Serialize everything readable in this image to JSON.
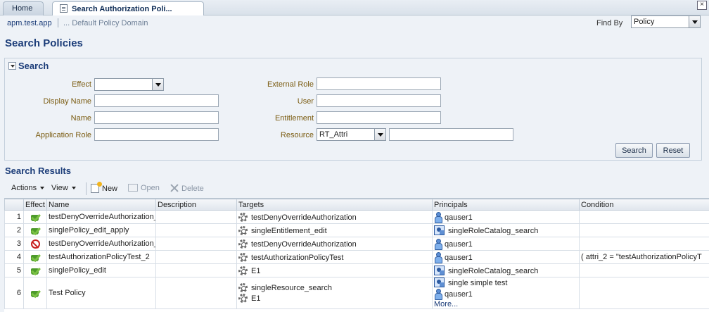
{
  "tabs": {
    "home": "Home",
    "active": "Search Authorization Poli..."
  },
  "breadcrumb": {
    "app": "apm.test.app",
    "domain": "... Default Policy Domain"
  },
  "find_by": {
    "label": "Find By",
    "value": "Policy"
  },
  "page_title": "Search Policies",
  "search": {
    "header": "Search",
    "effect_label": "Effect",
    "effect_value": "",
    "display_name_label": "Display Name",
    "name_label": "Name",
    "application_role_label": "Application Role",
    "external_role_label": "External Role",
    "user_label": "User",
    "entitlement_label": "Entitlement",
    "resource_label": "Resource",
    "resource_type_value": "RT_Attri",
    "resource_value": "",
    "search_button": "Search",
    "reset_button": "Reset"
  },
  "results": {
    "title": "Search Results",
    "toolbar": {
      "actions": "Actions",
      "view": "View",
      "new": "New",
      "open": "Open",
      "delete": "Delete"
    },
    "columns": [
      "",
      "Effect",
      "Name",
      "Description",
      "Targets",
      "Principals",
      "Condition"
    ],
    "rows": [
      {
        "num": "1",
        "effect": "grant",
        "name": "testDenyOverrideAuthorization_",
        "description": "",
        "targets": [
          {
            "icon": "entitlement-gear-icon",
            "text": "testDenyOverrideAuthorization"
          }
        ],
        "principals": [
          {
            "icon": "user-icon",
            "text": "qauser1"
          }
        ],
        "more": "",
        "condition": ""
      },
      {
        "num": "2",
        "effect": "grant",
        "name": "singlePolicy_edit_apply",
        "description": "",
        "targets": [
          {
            "icon": "resource-gear-icon",
            "text": "singleEntitlement_edit"
          }
        ],
        "principals": [
          {
            "icon": "app-role-icon",
            "text": "singleRoleCatalog_search"
          }
        ],
        "more": "",
        "condition": ""
      },
      {
        "num": "3",
        "effect": "deny",
        "name": "testDenyOverrideAuthorization_",
        "description": "",
        "targets": [
          {
            "icon": "entitlement-gear-icon",
            "text": "testDenyOverrideAuthorization"
          }
        ],
        "principals": [
          {
            "icon": "user-icon",
            "text": "qauser1"
          }
        ],
        "more": "",
        "condition": ""
      },
      {
        "num": "4",
        "effect": "grant",
        "name": "testAuthorizationPolicyTest_2",
        "description": "",
        "targets": [
          {
            "icon": "entitlement-gear-icon",
            "text": "testAuthorizationPolicyTest"
          }
        ],
        "principals": [
          {
            "icon": "user-icon",
            "text": "qauser1"
          }
        ],
        "more": "",
        "condition": "( attri_2 = \"testAuthorizationPolicyT"
      },
      {
        "num": "5",
        "effect": "grant",
        "name": "singlePolicy_edit",
        "description": "",
        "targets": [
          {
            "icon": "resource-gear-icon",
            "text": "E1"
          }
        ],
        "principals": [
          {
            "icon": "app-role-icon",
            "text": "singleRoleCatalog_search"
          }
        ],
        "more": "",
        "condition": ""
      },
      {
        "num": "6",
        "effect": "grant",
        "name": "Test Policy",
        "description": "",
        "targets": [
          {
            "icon": "resource-gear-icon",
            "text": "singleResource_search"
          },
          {
            "icon": "resource-gear-icon",
            "text": "E1"
          }
        ],
        "principals": [
          {
            "icon": "app-role-icon",
            "text": "single simple test"
          },
          {
            "icon": "user-icon",
            "text": "qauser1"
          }
        ],
        "more": "More...",
        "condition": ""
      }
    ]
  }
}
